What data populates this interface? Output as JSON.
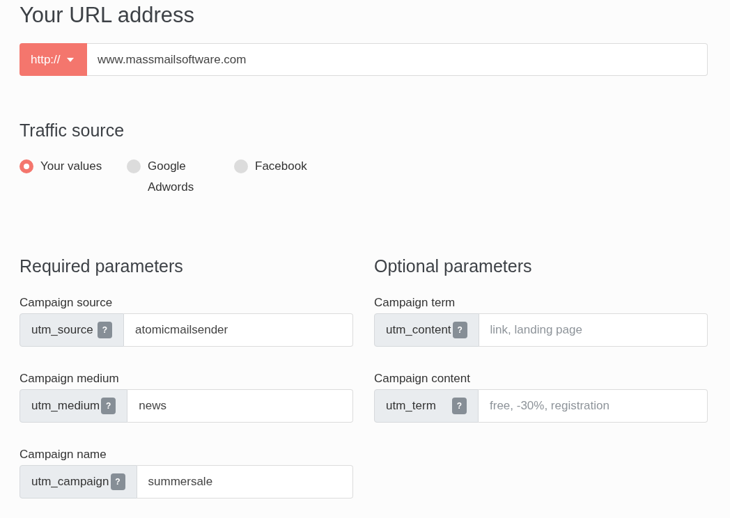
{
  "url_section": {
    "title": "Your URL address",
    "protocol": {
      "label": "http://"
    },
    "url": {
      "value": "www.massmailsoftware.com"
    }
  },
  "traffic_source": {
    "title": "Traffic source",
    "options": [
      {
        "label": "Your values",
        "selected": true
      },
      {
        "label": "Google Adwords",
        "selected": false
      },
      {
        "label": "Facebook",
        "selected": false
      }
    ]
  },
  "required_parameters": {
    "title": "Required parameters",
    "fields": [
      {
        "label": "Campaign source",
        "parameter": "utm_source",
        "help": "?",
        "value": "atomicmailsender"
      },
      {
        "label": "Campaign medium",
        "parameter": "utm_medium",
        "help": "?",
        "value": "news"
      },
      {
        "label": "Campaign name",
        "parameter": "utm_campaign",
        "help": "?",
        "value": "summersale"
      }
    ]
  },
  "optional_parameters": {
    "title": "Optional parameters",
    "fields": [
      {
        "label": "Campaign term",
        "parameter": "utm_content",
        "help": "?",
        "placeholder": "link, landing page"
      },
      {
        "label": "Campaign content",
        "parameter": "utm_term",
        "help": "?",
        "placeholder": "free, -30%, registration"
      }
    ]
  }
}
